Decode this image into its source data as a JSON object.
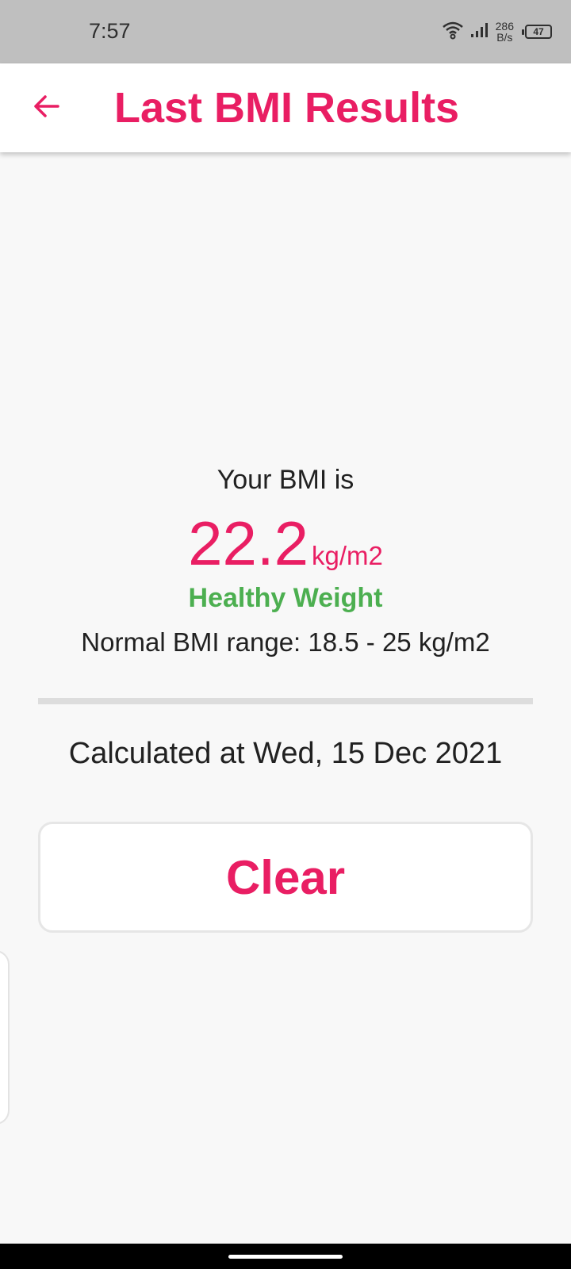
{
  "status_bar": {
    "time": "7:57",
    "net_speed_value": "286",
    "net_speed_unit": "B/s",
    "battery_level": "47",
    "icons": [
      "wifi-icon",
      "signal-icon",
      "battery-icon"
    ]
  },
  "app_bar": {
    "title": "Last BMI Results",
    "back_icon": "arrow-left-icon"
  },
  "result": {
    "label": "Your BMI is",
    "value": "22.2",
    "unit": "kg/m2",
    "category": "Healthy Weight",
    "normal_range": "Normal BMI range: 18.5 - 25 kg/m2"
  },
  "calculated_at": "Calculated at Wed, 15 Dec 2021",
  "actions": {
    "clear_label": "Clear"
  },
  "colors": {
    "accent": "#e91e63",
    "healthy": "#4caf50",
    "background": "#f8f8f8",
    "status_bar": "#bfbfbf"
  }
}
